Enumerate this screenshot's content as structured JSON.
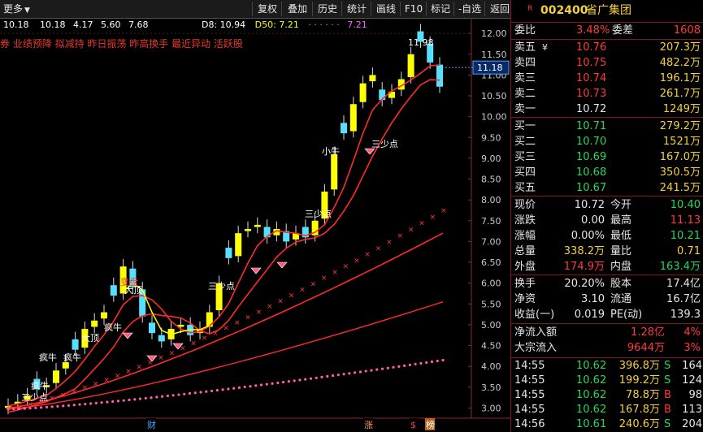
{
  "toolbar": {
    "menu_label": "更多",
    "buttons": [
      "复权",
      "叠加",
      "历史",
      "统计",
      "画线",
      "F10",
      "标记",
      "-自选",
      "返回"
    ]
  },
  "info_line": {
    "price_vals": [
      "10.18",
      "10.18",
      "4.17",
      "5.60",
      "7.68"
    ],
    "d8": "D8: 10.94",
    "d50": "D50: 7.21",
    "extra": "7.21"
  },
  "tags_line": "券 业绩预降 拟减持 昨日振荡 昨高换手 最近异动 活跃股",
  "price_tag": "11.18",
  "axis_ticks": [
    "12.00",
    "11.50",
    "11.00",
    "10.50",
    "10.00",
    "9.50",
    "9.00",
    "8.50",
    "8.00",
    "7.50",
    "7.00",
    "6.50",
    "6.00",
    "5.50",
    "5.00",
    "4.50",
    "4.00",
    "3.50",
    "3.00"
  ],
  "annotations": {
    "high": "11.98",
    "low": "2.95",
    "sanshao1": "三少点",
    "sanshao2": "三少点",
    "sanshao3": "三少点",
    "xiaoniu": "小牛",
    "bianpan": "变盘",
    "dading1": "大顶",
    "dading2": "大顶",
    "fengniu1": "疯牛",
    "fengniu2": "疯牛",
    "fengniu3": "疯牛",
    "fengniu4": "疯牛",
    "fengniu5": "疯牛",
    "sanshao0": "三少点",
    "bottom_markers": [
      "财",
      "涨",
      "$",
      "榜"
    ]
  },
  "chart_data": {
    "type": "candlestick",
    "y_range": [
      2.95,
      12.1
    ],
    "last_price": 11.18,
    "moving_averages": [
      "D8",
      "D50"
    ]
  },
  "quote": {
    "code": "002400",
    "name": "省广集团",
    "weibi_label": "委比",
    "weibi_value": "3.48%",
    "weicha_label": "委差",
    "weicha_value": "1608",
    "sells": [
      {
        "label": "卖五",
        "price": "10.76",
        "vol": "207.3万",
        "extra": "¥"
      },
      {
        "label": "卖四",
        "price": "10.75",
        "vol": "482.2万",
        "extra": ""
      },
      {
        "label": "卖三",
        "price": "10.74",
        "vol": "196.1万",
        "extra": ""
      },
      {
        "label": "卖二",
        "price": "10.73",
        "vol": "261.7万",
        "extra": ""
      },
      {
        "label": "卖一",
        "price": "10.72",
        "vol": "1249万",
        "extra": ""
      }
    ],
    "buys": [
      {
        "label": "买一",
        "price": "10.71",
        "vol": "279.2万"
      },
      {
        "label": "买二",
        "price": "10.70",
        "vol": "1521万"
      },
      {
        "label": "买三",
        "price": "10.69",
        "vol": "167.0万"
      },
      {
        "label": "买四",
        "price": "10.68",
        "vol": "350.5万"
      },
      {
        "label": "买五",
        "price": "10.67",
        "vol": "241.5万"
      }
    ],
    "stats1": [
      {
        "l1": "现价",
        "v1": "10.72",
        "l2": "今开",
        "v2": "10.40"
      },
      {
        "l1": "涨跌",
        "v1": "0.00",
        "l2": "最高",
        "v2": "11.13"
      },
      {
        "l1": "涨幅",
        "v1": "0.00%",
        "l2": "最低",
        "v2": "10.21"
      },
      {
        "l1": "总量",
        "v1": "338.2万",
        "l2": "量比",
        "v2": "0.71"
      },
      {
        "l1": "外盘",
        "v1": "174.9万",
        "l2": "内盘",
        "v2": "163.4万"
      }
    ],
    "stats2": [
      {
        "l1": "换手",
        "v1": "20.20%",
        "l2": "股本",
        "v2": "17.4亿"
      },
      {
        "l1": "净资",
        "v1": "3.10",
        "l2": "流通",
        "v2": "16.7亿"
      },
      {
        "l1": "收益(一)",
        "v1": "0.019",
        "l2": "PE(动)",
        "v2": "139.3"
      }
    ],
    "flows": [
      {
        "label": "净流入额",
        "value": "1.28亿",
        "pct": "4%"
      },
      {
        "label": "大宗流入",
        "value": "9644万",
        "pct": "3%"
      }
    ],
    "ticks": [
      {
        "time": "14:55",
        "price": "10.62",
        "vol": "396.8万",
        "side": "S",
        "num": "164"
      },
      {
        "time": "14:55",
        "price": "10.62",
        "vol": "199.2万",
        "side": "S",
        "num": "124"
      },
      {
        "time": "14:55",
        "price": "10.62",
        "vol": "78.8万",
        "side": "B",
        "num": "98"
      },
      {
        "time": "14:55",
        "price": "10.62",
        "vol": "167.8万",
        "side": "B",
        "num": "113"
      },
      {
        "time": "14:56",
        "price": "10.61",
        "vol": "240.6万",
        "side": "S",
        "num": "204"
      }
    ]
  },
  "colors": {
    "up": "#ffff00",
    "down": "#54e0ff",
    "ma_red": "#ff2b2b",
    "ma_yellow": "#ffff00",
    "axis": "#8a2b2b"
  }
}
